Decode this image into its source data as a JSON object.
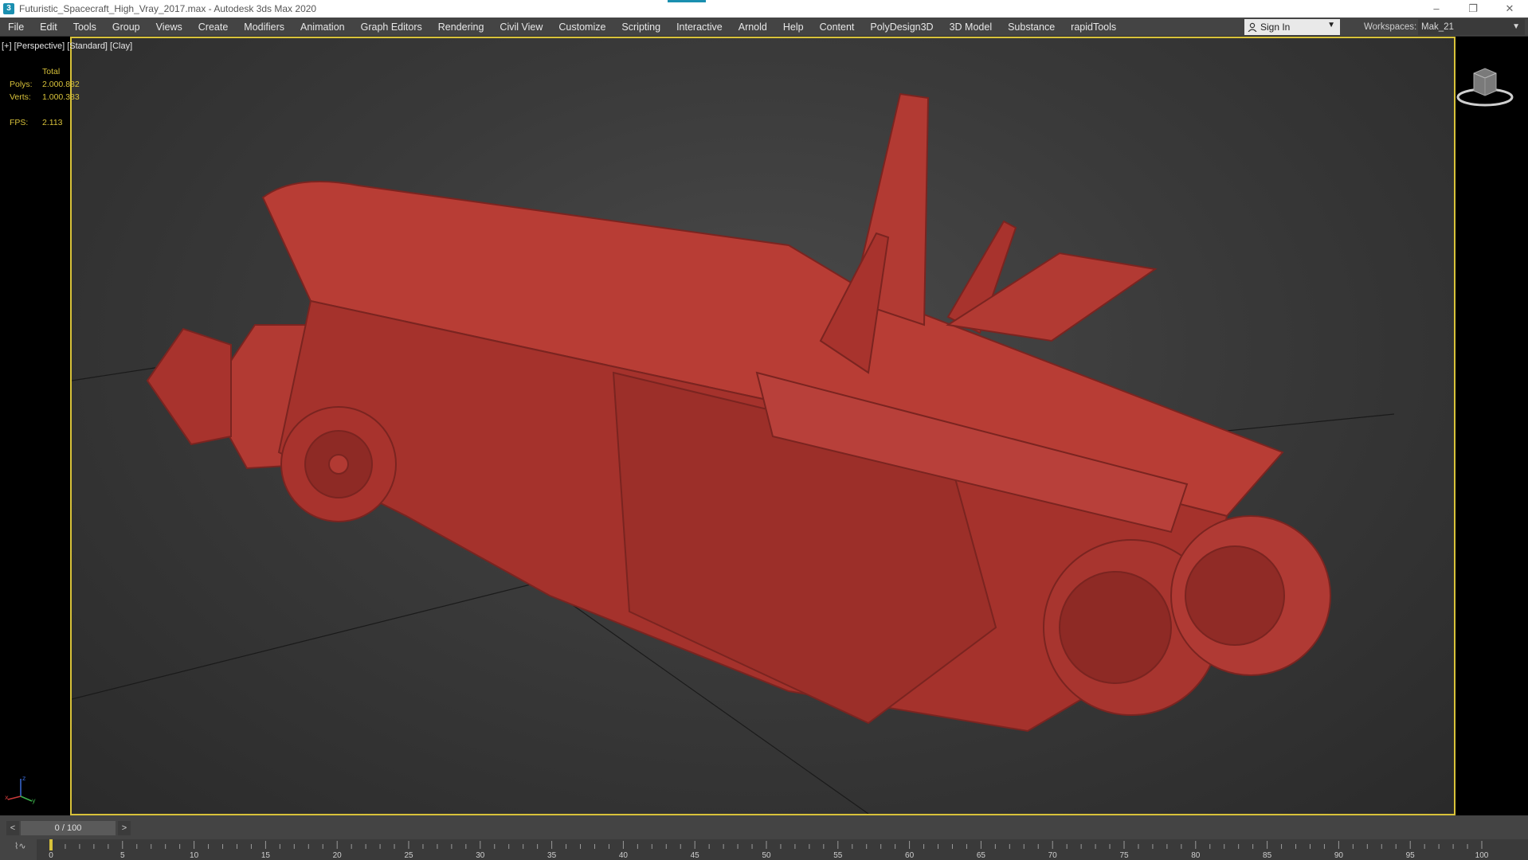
{
  "window": {
    "title": "Futuristic_Spacecraft_High_Vray_2017.max - Autodesk 3ds Max 2020",
    "controls": [
      "–",
      "❐",
      "✕"
    ]
  },
  "menu": {
    "items": [
      "File",
      "Edit",
      "Tools",
      "Group",
      "Views",
      "Create",
      "Modifiers",
      "Animation",
      "Graph Editors",
      "Rendering",
      "Civil View",
      "Customize",
      "Scripting",
      "Interactive",
      "Arnold",
      "Help",
      "Content",
      "PolyDesign3D",
      "3D Model",
      "Substance",
      "rapidTools"
    ],
    "sign_in": "Sign In",
    "workspaces_label": "Workspaces:",
    "workspace_value": "Mak_21"
  },
  "viewport": {
    "label": "[+] [Perspective] [Standard] [Clay]",
    "stats": {
      "header": "Total",
      "polys_label": "Polys:",
      "polys_value": "2.000.882",
      "verts_label": "Verts:",
      "verts_value": "1.000.383",
      "fps_label": "FPS:",
      "fps_value": "2.113"
    },
    "border_color": "#d8c23a",
    "model_color": "#b23a33"
  },
  "timeline": {
    "frame": "0 / 100",
    "prev": "<",
    "next": ">",
    "ticks": [
      "0",
      "5",
      "10",
      "15",
      "20",
      "25",
      "30",
      "35",
      "40",
      "45",
      "50",
      "55",
      "60",
      "65",
      "70",
      "75",
      "80",
      "85",
      "90",
      "95",
      "100"
    ]
  }
}
